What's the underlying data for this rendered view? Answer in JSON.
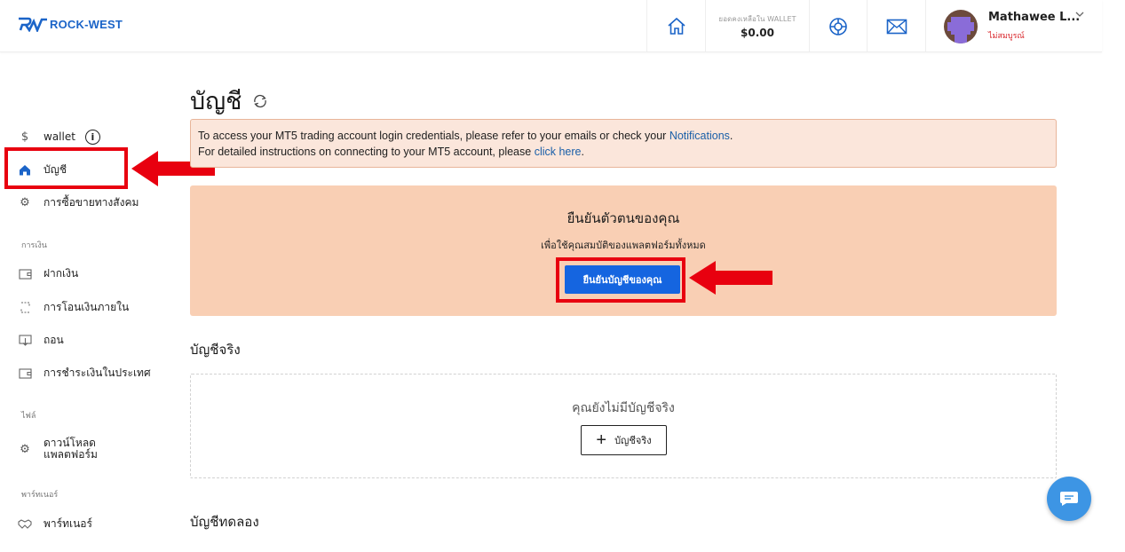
{
  "header": {
    "logo_text": "ROCK-WEST",
    "wallet_label": "ยอดคงเหลือใน WALLET",
    "wallet_value": "$0.00",
    "user_name": "Mathawee L...",
    "user_status": "ไม่สมบูรณ์"
  },
  "sidebar": {
    "items": [
      {
        "label": "wallet",
        "icon": "dollar-icon"
      },
      {
        "label": "บัญชี",
        "icon": "home-icon"
      },
      {
        "label": "การซื้อขายทางสังคม",
        "icon": "gear-icon"
      }
    ],
    "section_finance": "การเงิน",
    "finance_items": [
      {
        "label": "ฝากเงิน",
        "icon": "wallet-icon"
      },
      {
        "label": "การโอนเงินภายใน",
        "icon": "transfer-icon"
      },
      {
        "label": "ถอน",
        "icon": "withdraw-icon"
      },
      {
        "label": "การชำระเงินในประเทศ",
        "icon": "wallet-icon"
      }
    ],
    "section_files": "ไฟล์",
    "files_item_line1": "ดาวน์โหลด",
    "files_item_line2": "แพลตฟอร์ม",
    "section_partner": "พาร์ทเนอร์",
    "partner_item": "พาร์ทเนอร์"
  },
  "main": {
    "title": "บัญชี",
    "notice_line1_pre": "To access your MT5 trading account login credentials, please refer to your emails or check your ",
    "notice_line1_link": "Notifications",
    "notice_line1_post": ".",
    "notice_line2_pre": "For detailed instructions on connecting to your MT5 account, please ",
    "notice_line2_link": "click here",
    "notice_line2_post": ".",
    "verify_title": "ยืนยันตัวตนของคุณ",
    "verify_sub": "เพื่อใช้คุณสมบัติของแพลตฟอร์มทั้งหมด",
    "verify_button": "ยืนยันบัญชีของคุณ",
    "real_header": "บัญชีจริง",
    "real_empty": "คุณยังไม่มีบัญชีจริง",
    "real_add_button": "บัญชีจริง",
    "demo_header": "บัญชีทดลอง"
  },
  "colors": {
    "brand": "#1b64c8",
    "accent_button": "#1565e0",
    "annotation_red": "#e8000f",
    "notice_bg": "#fbe6db",
    "verify_bg": "#f9cfb4"
  }
}
